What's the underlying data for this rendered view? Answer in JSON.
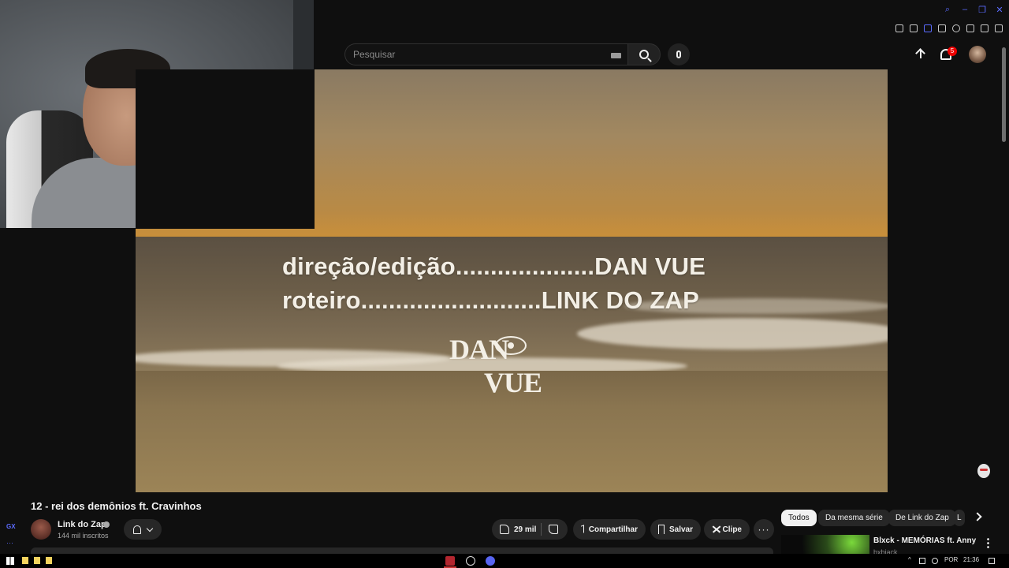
{
  "search": {
    "placeholder": "Pesquisar"
  },
  "notifications": {
    "count": "5"
  },
  "video": {
    "credits_line1": "direção/edição....................DAN VUE",
    "credits_line2": "roteiro..........................LINK DO ZAP",
    "logo_left": "DAN",
    "logo_right": "VUE"
  },
  "title": "12 - rei dos demônios ft. Cravinhos",
  "channel": {
    "name": "Link do Zap",
    "subscribers": "144 mil inscritos"
  },
  "actions": {
    "likes": "29 mil",
    "share": "Compartilhar",
    "save": "Salvar",
    "clip": "Clipe",
    "more": "···"
  },
  "chips": [
    "Todos",
    "Da mesma série",
    "De Link do Zap",
    "L"
  ],
  "recommendation": {
    "title": "Blxck - MEMÓRIAS ft. Anny",
    "channel": "bxbiack"
  },
  "sidebar": {
    "gx": "GX",
    "dots": "···"
  },
  "taskbar": {
    "lang": "POR",
    "time": "21:36"
  }
}
